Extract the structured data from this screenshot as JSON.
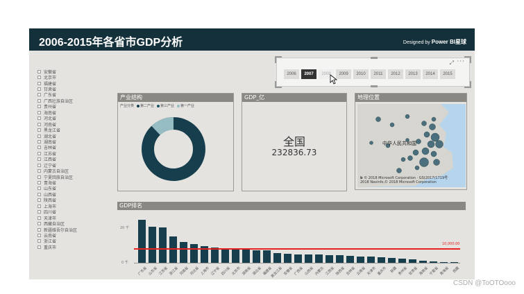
{
  "header": {
    "title": "2006-2015年各省市GDP分析",
    "designed_prefix": "Designed by",
    "designed_brand": "Power BI星球"
  },
  "provinces": [
    "安徽省",
    "北京市",
    "福建省",
    "甘肃省",
    "广东省",
    "广西壮族自治区",
    "贵州省",
    "海南省",
    "河北省",
    "河南省",
    "黑龙江省",
    "湖北省",
    "湖南省",
    "吉林省",
    "江苏省",
    "江西省",
    "辽宁省",
    "内蒙古自治区",
    "宁夏回族自治区",
    "青海省",
    "山东省",
    "山西省",
    "陕西省",
    "上海市",
    "四川省",
    "天津市",
    "西藏自治区",
    "新疆维吾尔自治区",
    "云南省",
    "浙江省",
    "重庆市"
  ],
  "slicer": {
    "years": [
      "2006",
      "2007",
      "2008",
      "2009",
      "2010",
      "2011",
      "2012",
      "2013",
      "2014",
      "2015"
    ],
    "selected": "2007",
    "focus_icon": "focus-mode-icon",
    "more_icon": "more-options-icon"
  },
  "structure": {
    "title": "产业结构",
    "legend_label": "产业分类",
    "legend": [
      {
        "name": "第二产业",
        "color": "#173e4d"
      },
      {
        "name": "第三产业",
        "color": "#1d5566"
      },
      {
        "name": "第一产业",
        "color": "#95bdc3"
      }
    ]
  },
  "card": {
    "title": "GDP_亿",
    "label": "全国",
    "value": "232836.73"
  },
  "map": {
    "title": "地理位置",
    "country_label": "中华人民共和国",
    "copyright_1": "© 2018 Microsoft Corporation · GS(2017)1719号",
    "copyright_2": "2018 Navinfo,© 2018 Microsoft Corporation"
  },
  "ranking": {
    "title": "GDP排名",
    "y_ticks": [
      "20 千",
      "0 千"
    ],
    "ref_label": "10,000.00",
    "ref_value": 10000
  },
  "chart_data": {
    "type": "bar",
    "title": "GDP排名",
    "categories": [
      "广东省",
      "山东省",
      "江苏省",
      "浙江省",
      "河南省",
      "河北省",
      "上海市",
      "辽宁省",
      "四川省",
      "北京市",
      "湖南省",
      "湖北省",
      "福建省",
      "黑龙江省",
      "安徽省",
      "广西省",
      "山西省",
      "内蒙古",
      "江西省",
      "陕西省",
      "吉林省",
      "云南省",
      "天津市",
      "重庆市",
      "新疆",
      "贵州省",
      "甘肃省",
      "海南省",
      "宁夏省",
      "青海省",
      "西藏"
    ],
    "values": [
      31000,
      25800,
      25600,
      18800,
      15000,
      13700,
      12200,
      11100,
      10500,
      9800,
      9300,
      9100,
      9000,
      7000,
      6300,
      6000,
      5900,
      5800,
      5400,
      5300,
      5200,
      4600,
      4400,
      4100,
      3500,
      2800,
      2500,
      1300,
      900,
      750,
      350
    ],
    "ylim": [
      0,
      32000
    ],
    "reference_line": 10000
  },
  "watermark": "CSDN @ToOTOooo"
}
